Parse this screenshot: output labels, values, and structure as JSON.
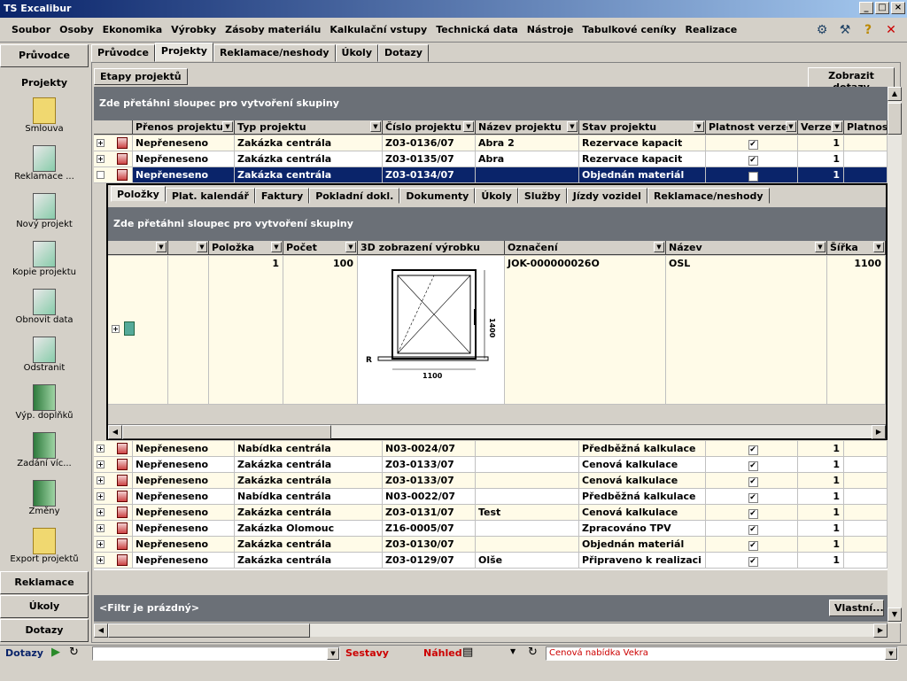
{
  "window": {
    "title": "TS Excalibur"
  },
  "menu": [
    "Soubor",
    "Osoby",
    "Ekonomika",
    "Výrobky",
    "Zásoby materiálu",
    "Kalkulační vstupy",
    "Technická data",
    "Nástroje",
    "Tabulkové ceníky",
    "Realizace"
  ],
  "nav": {
    "top_header": "Průvodce",
    "section_header": "Projekty",
    "items": [
      "Smlouva",
      "Reklamace ...",
      "Nový projekt",
      "Kopie projektu",
      "Obnovit data",
      "Odstranit",
      "Výp. doplňků",
      "Zadání víc...",
      "Změny",
      "Export projektů"
    ],
    "bottom_headers": [
      "Reklamace",
      "Úkoly",
      "Dotazy"
    ]
  },
  "main_tabs": [
    "Průvodce",
    "Projekty",
    "Reklamace/neshody",
    "Úkoly",
    "Dotazy"
  ],
  "active_main_tab": "Projekty",
  "panel": {
    "tab_label": "Etapy projektů",
    "show_queries_button": "Zobrazit dotazy",
    "group_hint": "Zde přetáhni sloupec pro vytvoření skupiny",
    "filter_text": "<Filtr je prázdný>",
    "custom_button": "Vlastní..."
  },
  "grid": {
    "columns": [
      "Přenos projektu",
      "Typ projektu",
      "Číslo projektu",
      "Název projektu",
      "Stav projektu",
      "Platnost verze",
      "Verze",
      "Platnost"
    ],
    "top_rows": [
      {
        "transfer": "Nepřeneseno",
        "type": "Zakázka centrála",
        "number": "Z03-0136/07",
        "name": "Abra 2",
        "status": "Rezervace kapacit",
        "valid": "✔",
        "version": "1",
        "selected": false
      },
      {
        "transfer": "Nepřeneseno",
        "type": "Zakázka centrála",
        "number": "Z03-0135/07",
        "name": "Abra",
        "status": "Rezervace kapacit",
        "valid": "✔",
        "version": "1",
        "selected": false
      },
      {
        "transfer": "Nepřeneseno",
        "type": "Zakázka centrála",
        "number": "Z03-0134/07",
        "name": "",
        "status": "Objednán materiál",
        "valid": "✔",
        "version": "1",
        "selected": true
      }
    ],
    "bottom_rows": [
      {
        "transfer": "Nepřeneseno",
        "type": "Nabídka centrála",
        "number": "N03-0024/07",
        "name": "",
        "status": "Předběžná kalkulace",
        "valid": "✔",
        "version": "1"
      },
      {
        "transfer": "Nepřeneseno",
        "type": "Zakázka centrála",
        "number": "Z03-0133/07",
        "name": "",
        "status": "Cenová kalkulace",
        "valid": "✔",
        "version": "1"
      },
      {
        "transfer": "Nepřeneseno",
        "type": "Zakázka centrála",
        "number": "Z03-0133/07",
        "name": "",
        "status": "Cenová kalkulace",
        "valid": "✔",
        "version": "1"
      },
      {
        "transfer": "Nepřeneseno",
        "type": "Nabídka centrála",
        "number": "N03-0022/07",
        "name": "",
        "status": "Předběžná kalkulace",
        "valid": "✔",
        "version": "1"
      },
      {
        "transfer": "Nepřeneseno",
        "type": "Zakázka centrála",
        "number": "Z03-0131/07",
        "name": "Test",
        "status": "Cenová kalkulace",
        "valid": "✔",
        "version": "1"
      },
      {
        "transfer": "Nepřeneseno",
        "type": "Zakázka Olomouc",
        "number": "Z16-0005/07",
        "name": "",
        "status": "Zpracováno TPV",
        "valid": "✔",
        "version": "1"
      },
      {
        "transfer": "Nepřeneseno",
        "type": "Zakázka centrála",
        "number": "Z03-0130/07",
        "name": "",
        "status": "Objednán materiál",
        "valid": "✔",
        "version": "1"
      },
      {
        "transfer": "Nepřeneseno",
        "type": "Zakázka centrála",
        "number": "Z03-0129/07",
        "name": "Olše",
        "status": "Připraveno k realizaci",
        "valid": "✔",
        "version": "1"
      }
    ]
  },
  "detail": {
    "tabs": [
      "Položky",
      "Plat. kalendář",
      "Faktury",
      "Pokladní dokl.",
      "Dokumenty",
      "Úkoly",
      "Služby",
      "Jízdy vozidel",
      "Reklamace/neshody"
    ],
    "active_tab": "Položky",
    "group_hint": "Zde přetáhni sloupec pro vytvoření skupiny",
    "columns": [
      "Položka",
      "Počet",
      "3D zobrazení výrobku",
      "Označení",
      "Název",
      "Šířka"
    ],
    "row": {
      "item": "1",
      "count": "100",
      "code": "JOK-000000026O",
      "name": "OSL",
      "width": "1100"
    },
    "drawing": {
      "width_label": "1100",
      "height_label": "1400",
      "side_label": "R"
    }
  },
  "statusbar": {
    "label": "Dotazy",
    "reports": "Sestavy",
    "preview": "Náhled",
    "offer": "Cenová nabídka Vekra"
  }
}
